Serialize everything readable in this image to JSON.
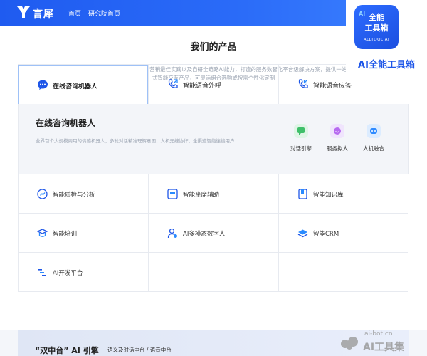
{
  "header": {
    "brand": "言犀",
    "nav": [
      "首页",
      "研究院首页"
    ]
  },
  "products": {
    "title": "我们的产品",
    "description": "融合京东自身十年客服服务与营销最佳实践以及自研全链路AI能力，打造的服务数智化平台级解决方案，提供一站式智能交互产品，可灵活组合选购或按需个性化定制",
    "tabs": [
      {
        "label": "在线咨询机器人",
        "icon": "chat-bubble-icon"
      },
      {
        "label": "智能语音外呼",
        "icon": "phone-outgoing-icon"
      },
      {
        "label": "智能语音应答",
        "icon": "phone-incoming-icon"
      }
    ],
    "selected_tab": "在线咨询机器人",
    "detail": {
      "title": "在线咨询机器人",
      "description": "业界首个大规模商用的情感机器人，多轮对话精准理解意图，人机无缝协作，全渠道智能连接用户",
      "features": [
        {
          "label": "对话引擎",
          "color": "#3fbf6a"
        },
        {
          "label": "服务拟人",
          "color": "#b66af0"
        },
        {
          "label": "人机融合",
          "color": "#2f8bff"
        }
      ]
    },
    "grid": [
      {
        "label": "智能质检与分析",
        "icon": "quality-check-icon"
      },
      {
        "label": "智能坐席辅助",
        "icon": "agent-assist-icon"
      },
      {
        "label": "智能知识库",
        "icon": "knowledge-base-icon"
      },
      {
        "label": "智能培训",
        "icon": "training-icon"
      },
      {
        "label": "AI多模态数字人",
        "icon": "digital-human-icon"
      },
      {
        "label": "智能CRM",
        "icon": "crm-icon"
      },
      {
        "label": "AI开发平台",
        "icon": "dev-platform-icon"
      }
    ]
  },
  "engine": {
    "title": "“双中台” AI 引擎",
    "subtitle": "语义及对话中台 / 语音中台"
  },
  "badge": {
    "line1": "全能",
    "line2": "工具箱",
    "ai": "AI",
    "line3": "ALLTOOL.AI",
    "text": "AI全能工具箱"
  },
  "watermark": {
    "url": "ai-bot.cn",
    "name": "AI工具集"
  },
  "colors": {
    "accent": "#2a6bf8",
    "tab_border": "#9ec1f7",
    "text_muted": "#9aa3b1"
  }
}
